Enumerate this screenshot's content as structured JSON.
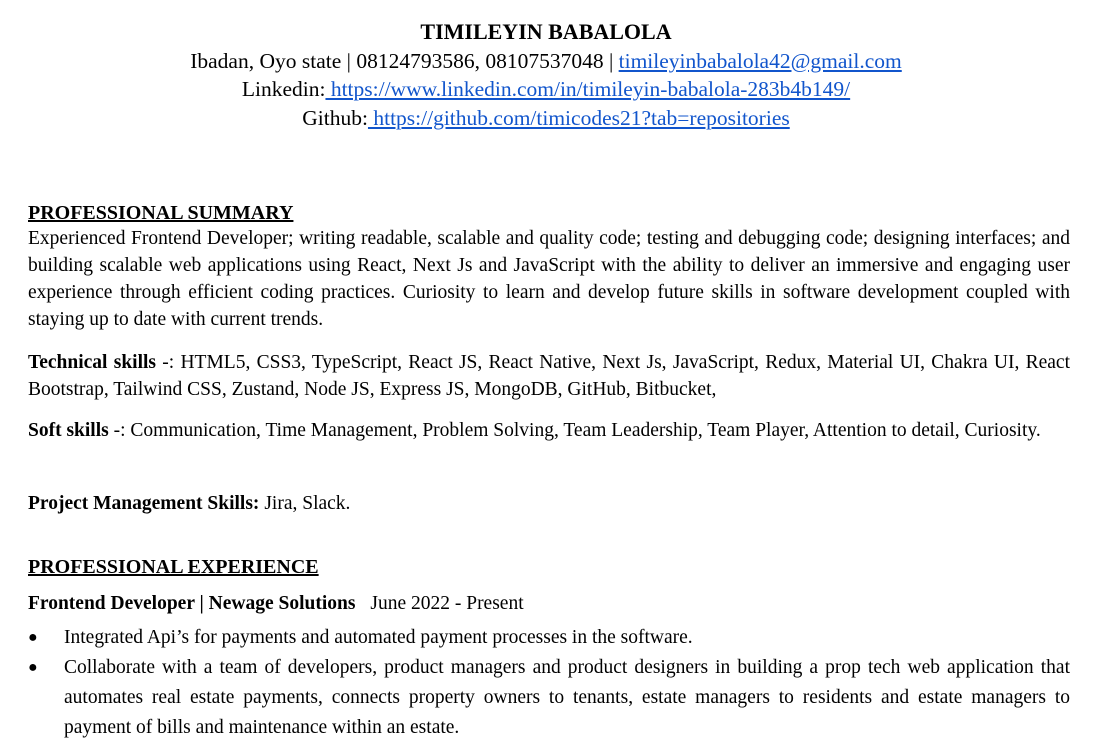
{
  "header": {
    "name": "TIMILEYIN BABALOLA",
    "contact_prefix": "Ibadan, Oyo state | 08124793586, 08107537048 | ",
    "email": "timileyinbabalola42@gmail.com",
    "linkedin_label": "Linkedin:",
    "linkedin_url": " https://www.linkedin.com/in/timileyin-babalola-283b4b149/",
    "github_label": "Github:",
    "github_url": " https://github.com/timicodes21?tab=repositories"
  },
  "summary": {
    "title": "PROFESSIONAL SUMMARY",
    "text": "Experienced Frontend Developer; writing readable, scalable and quality code; testing and debugging code; designing interfaces; and building scalable web applications using React, Next Js and JavaScript with the ability to deliver an immersive and engaging user experience through efficient coding practices. Curiosity to learn and develop future skills in software development coupled with staying up to date with current trends."
  },
  "skills": {
    "technical_label": "Technical skills",
    "technical_text": " -: HTML5, CSS3, TypeScript, React JS, React Native, Next Js, JavaScript, Redux, Material UI, Chakra UI, React Bootstrap, Tailwind CSS, Zustand, Node JS, Express JS, MongoDB, GitHub, Bitbucket,",
    "soft_label": "Soft skills",
    "soft_text": " -: Communication, Time Management, Problem Solving, Team Leadership, Team Player, Attention to detail, Curiosity.",
    "pm_label": "Project Management Skills:",
    "pm_text": " Jira, Slack."
  },
  "experience": {
    "title": "PROFESSIONAL EXPERIENCE",
    "job_title": "Frontend Developer | Newage Solutions",
    "job_dates": "June 2022 - Present",
    "bullets": [
      "Integrated Api’s for payments and automated payment processes in the software.",
      "Collaborate with a team of developers, product managers and product designers in building a prop tech web application that automates real estate payments, connects property owners to tenants,  estate managers to residents and estate managers to payment of bills and maintenance within an estate."
    ],
    "bullet_glyph": "●"
  }
}
